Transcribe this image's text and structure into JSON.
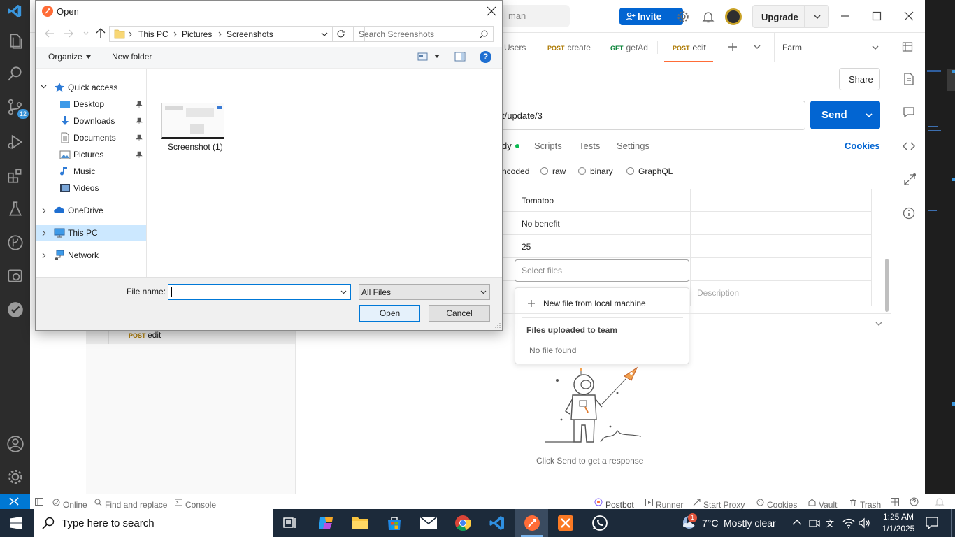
{
  "vscode": {
    "badge_count": "12",
    "icons": [
      "vscode-logo-icon",
      "explorer-icon",
      "search-icon",
      "source-control-icon",
      "run-debug-icon",
      "extensions-icon",
      "testing-icon",
      "git-graph-icon",
      "remote-icon",
      "check-icon",
      "account-icon",
      "manage-icon"
    ]
  },
  "postman": {
    "topbar": {
      "partial_title": "man",
      "invite_label": "Invite",
      "upgrade_label": "Upgrade"
    },
    "tabs": [
      {
        "method": "",
        "label": "Users"
      },
      {
        "method": "POST",
        "label": "create"
      },
      {
        "method": "GET",
        "label": "getAd"
      },
      {
        "method": "POST",
        "label": "edit"
      }
    ],
    "environment": "Farm",
    "share_label": "Share",
    "url_suffix": "t/update/3",
    "send_label": "Send",
    "request_tabs": [
      "dy",
      "Scripts",
      "Tests",
      "Settings"
    ],
    "cookies_label": "Cookies",
    "body_types": [
      "ncoded",
      "raw",
      "binary",
      "GraphQL"
    ],
    "kv_rows": [
      {
        "value": "Tomatoo"
      },
      {
        "value": "No benefit"
      },
      {
        "value": "25"
      }
    ],
    "select_files_placeholder": "Select files",
    "description_placeholder": "Description",
    "file_dropdown": {
      "new_file": "New file from local machine",
      "section_title": "Files uploaded to team",
      "empty": "No file found"
    },
    "response_hint": "Click Send to get a response",
    "sidebar_item": {
      "method": "POST",
      "label": "edit"
    },
    "status": {
      "online": "Online",
      "find_replace": "Find and replace",
      "console": "Console",
      "postbot": "Postbot",
      "runner": "Runner",
      "start_proxy": "Start Proxy",
      "cookies": "Cookies",
      "vault": "Vault",
      "trash": "Trash"
    },
    "colors": {
      "accent": "#ff6c37",
      "send_blue": "#0265d2",
      "get_green": "#007f31",
      "post_amber": "#ad7a03"
    }
  },
  "dialog": {
    "title": "Open",
    "breadcrumb": [
      "This PC",
      "Pictures",
      "Screenshots"
    ],
    "search_placeholder": "Search Screenshots",
    "organize_label": "Organize",
    "new_folder_label": "New folder",
    "nav": [
      {
        "label": "Quick access",
        "level": 0
      },
      {
        "label": "Desktop",
        "level": 1,
        "pinned": true
      },
      {
        "label": "Downloads",
        "level": 1,
        "pinned": true
      },
      {
        "label": "Documents",
        "level": 1,
        "pinned": true
      },
      {
        "label": "Pictures",
        "level": 1,
        "pinned": true
      },
      {
        "label": "Music",
        "level": 1,
        "pinned": false
      },
      {
        "label": "Videos",
        "level": 1,
        "pinned": false
      },
      {
        "label": "OneDrive",
        "level": 0
      },
      {
        "label": "This PC",
        "level": 0,
        "selected": true
      },
      {
        "label": "Network",
        "level": 0
      }
    ],
    "files": [
      {
        "name": "Screenshot (1)"
      }
    ],
    "file_name_label": "File name:",
    "file_name_value": "",
    "filter_value": "All Files",
    "open_label": "Open",
    "cancel_label": "Cancel"
  },
  "taskbar": {
    "search_placeholder": "Type here to search",
    "weather_temp": "7°C",
    "weather_text": "Mostly clear",
    "weather_badge": "1",
    "time": "1:25 AM",
    "date": "1/1/2025"
  }
}
